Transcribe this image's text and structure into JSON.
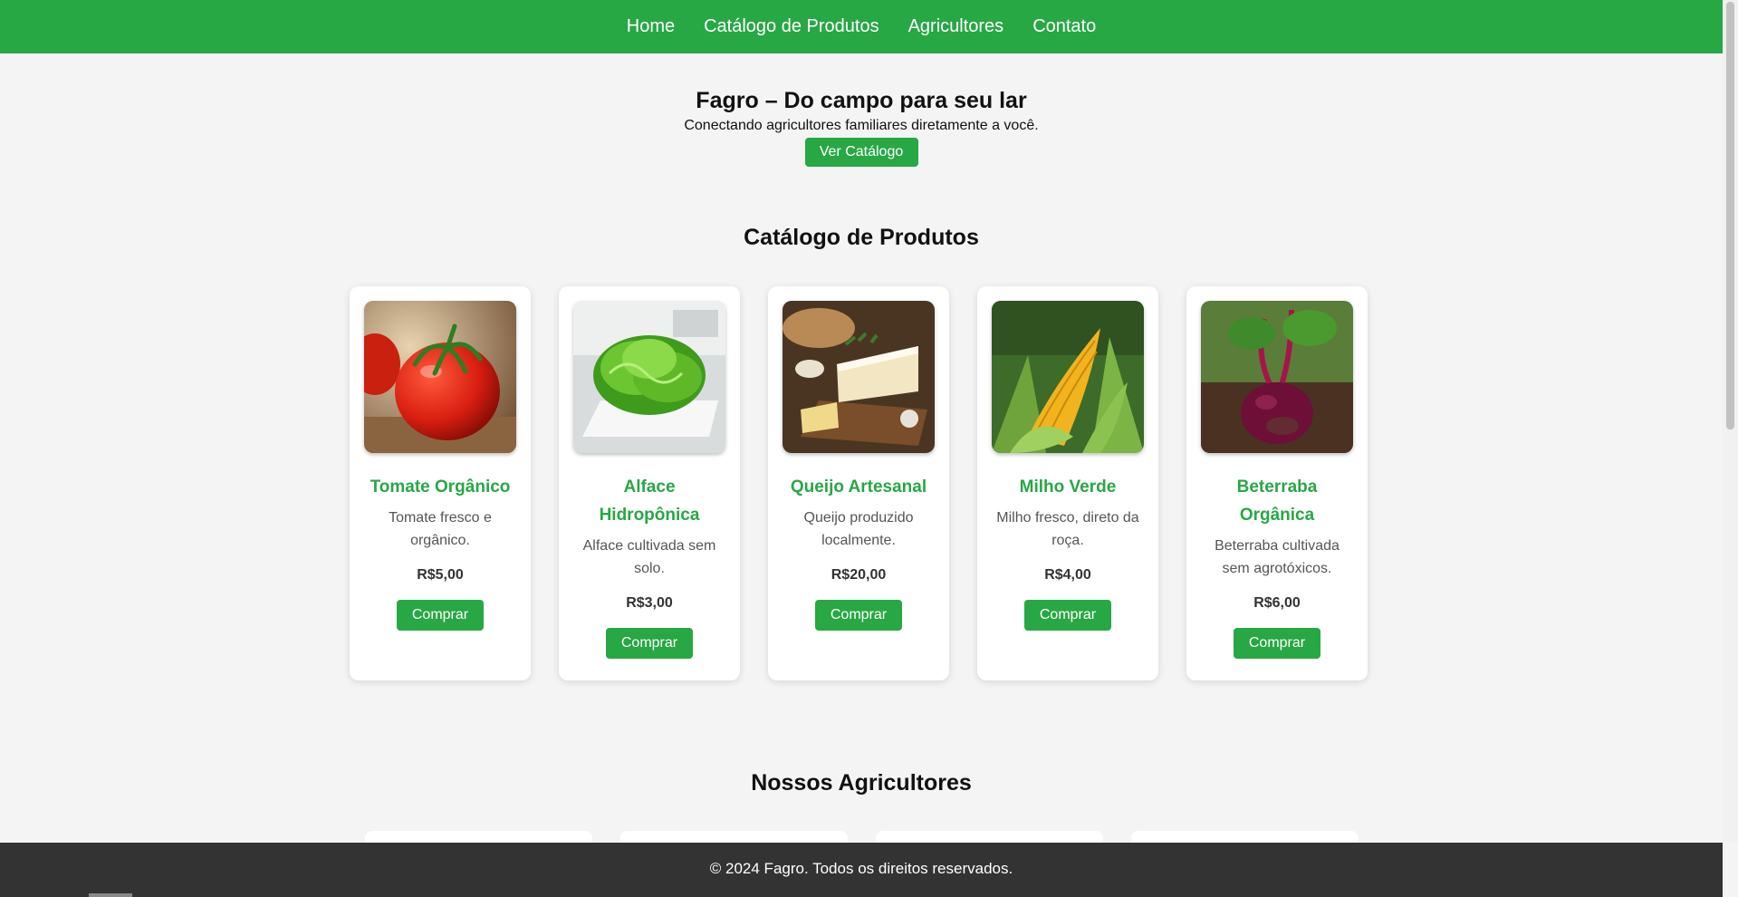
{
  "nav": {
    "items": [
      "Home",
      "Catálogo de Produtos",
      "Agricultores",
      "Contato"
    ]
  },
  "hero": {
    "title": "Fagro – Do campo para seu lar",
    "subtitle": "Conectando agricultores familiares diretamente a você.",
    "button": "Ver Catálogo"
  },
  "catalog": {
    "title": "Catálogo de Produtos",
    "products": [
      {
        "name": "Tomate Orgânico",
        "description": "Tomate fresco e orgânico.",
        "price": "R$5,00",
        "button": "Comprar",
        "icon": "tomato-image"
      },
      {
        "name": "Alface Hidropônica",
        "description": "Alface cultivada sem solo.",
        "price": "R$3,00",
        "button": "Comprar",
        "icon": "lettuce-image"
      },
      {
        "name": "Queijo Artesanal",
        "description": "Queijo produzido localmente.",
        "price": "R$20,00",
        "button": "Comprar",
        "icon": "cheese-image"
      },
      {
        "name": "Milho Verde",
        "description": "Milho fresco, direto da roça.",
        "price": "R$4,00",
        "button": "Comprar",
        "icon": "corn-image"
      },
      {
        "name": "Beterraba Orgânica",
        "description": "Beterraba cultivada sem agrotóxicos.",
        "price": "R$6,00",
        "button": "Comprar",
        "icon": "beet-image"
      }
    ]
  },
  "farmers": {
    "title": "Nossos Agricultores"
  },
  "footer": {
    "text": "© 2024 Fagro. Todos os direitos reservados."
  },
  "colors": {
    "accent": "#28a745",
    "background": "#f4f4f4",
    "footer": "#333333"
  }
}
